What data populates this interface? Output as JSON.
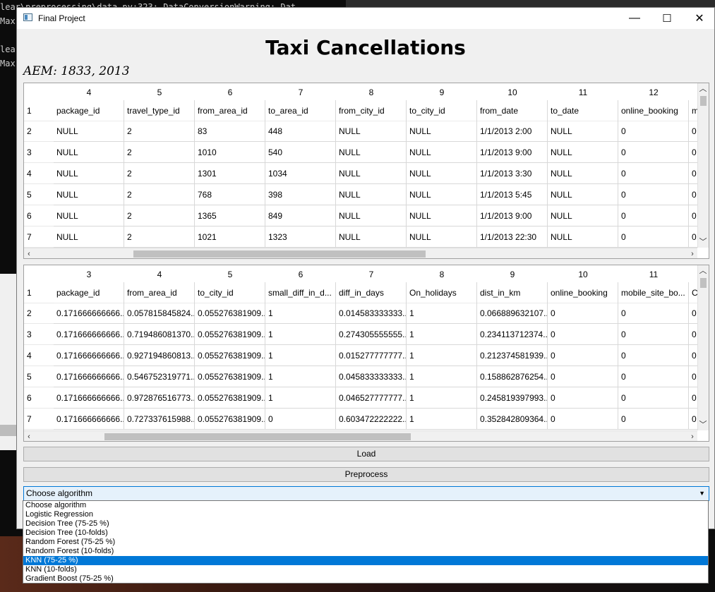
{
  "console": {
    "lines": [
      "lear\\preprocessing\\data.py:323: DataConversionWarning: Dat",
      "Max",
      "",
      "lear",
      "Max"
    ]
  },
  "window": {
    "title": "Final Project",
    "controls": {
      "minimize": "—",
      "maximize": "☐",
      "close": "✕"
    }
  },
  "heading": "Taxi Cancellations",
  "aem": "AEM: 1833, 2013",
  "table1": {
    "col_numbers": [
      "4",
      "5",
      "6",
      "7",
      "8",
      "9",
      "10",
      "11",
      "12"
    ],
    "rows": [
      {
        "num": "1",
        "cells": [
          "package_id",
          "travel_type_id",
          "from_area_id",
          "to_area_id",
          "from_city_id",
          "to_city_id",
          "from_date",
          "to_date",
          "online_booking",
          "m"
        ]
      },
      {
        "num": "2",
        "cells": [
          "NULL",
          "2",
          "83",
          "448",
          "NULL",
          "NULL",
          "1/1/2013 2:00",
          "NULL",
          "0",
          "0"
        ]
      },
      {
        "num": "3",
        "cells": [
          "NULL",
          "2",
          "1010",
          "540",
          "NULL",
          "NULL",
          "1/1/2013 9:00",
          "NULL",
          "0",
          "0"
        ]
      },
      {
        "num": "4",
        "cells": [
          "NULL",
          "2",
          "1301",
          "1034",
          "NULL",
          "NULL",
          "1/1/2013 3:30",
          "NULL",
          "0",
          "0"
        ]
      },
      {
        "num": "5",
        "cells": [
          "NULL",
          "2",
          "768",
          "398",
          "NULL",
          "NULL",
          "1/1/2013 5:45",
          "NULL",
          "0",
          "0"
        ]
      },
      {
        "num": "6",
        "cells": [
          "NULL",
          "2",
          "1365",
          "849",
          "NULL",
          "NULL",
          "1/1/2013 9:00",
          "NULL",
          "0",
          "0"
        ]
      },
      {
        "num": "7",
        "cells": [
          "NULL",
          "2",
          "1021",
          "1323",
          "NULL",
          "NULL",
          "1/1/2013 22:30",
          "NULL",
          "0",
          "0"
        ]
      }
    ]
  },
  "table2": {
    "col_numbers": [
      "3",
      "4",
      "5",
      "6",
      "7",
      "8",
      "9",
      "10",
      "11"
    ],
    "rows": [
      {
        "num": "1",
        "cells": [
          "package_id",
          "from_area_id",
          "to_city_id",
          "small_diff_in_d...",
          "diff_in_days",
          "On_holidays",
          "dist_in_km",
          "online_booking",
          "mobile_site_bo...",
          "C"
        ]
      },
      {
        "num": "2",
        "cells": [
          "0.171666666666...",
          "0.057815845824...",
          "0.055276381909...",
          "1",
          "0.014583333333...",
          "1",
          "0.066889632107...",
          "0",
          "0",
          "0"
        ]
      },
      {
        "num": "3",
        "cells": [
          "0.171666666666...",
          "0.719486081370...",
          "0.055276381909...",
          "1",
          "0.274305555555...",
          "1",
          "0.234113712374...",
          "0",
          "0",
          "0"
        ]
      },
      {
        "num": "4",
        "cells": [
          "0.171666666666...",
          "0.927194860813...",
          "0.055276381909...",
          "1",
          "0.015277777777...",
          "1",
          "0.212374581939...",
          "0",
          "0",
          "0"
        ]
      },
      {
        "num": "5",
        "cells": [
          "0.171666666666...",
          "0.546752319771...",
          "0.055276381909...",
          "1",
          "0.045833333333...",
          "1",
          "0.158862876254...",
          "0",
          "0",
          "0"
        ]
      },
      {
        "num": "6",
        "cells": [
          "0.171666666666...",
          "0.972876516773...",
          "0.055276381909...",
          "1",
          "0.046527777777...",
          "1",
          "0.245819397993...",
          "0",
          "0",
          "0"
        ]
      },
      {
        "num": "7",
        "cells": [
          "0.171666666666...",
          "0.727337615988...",
          "0.055276381909...",
          "0",
          "0.603472222222...",
          "1",
          "0.352842809364...",
          "0",
          "0",
          "0"
        ]
      }
    ]
  },
  "buttons": {
    "load": "Load",
    "preprocess": "Preprocess"
  },
  "algorithm": {
    "selected": "Choose algorithm",
    "options": [
      "Choose algorithm",
      "Logistic Regression",
      "Decision Tree (75-25 %)",
      "Decision Tree (10-folds)",
      "Random Forest (75-25 %)",
      "Random Forest (10-folds)",
      "KNN (75-25 %)",
      "KNN (10-folds)",
      "Gradient Boost (75-25 %)"
    ],
    "highlighted_index": 6
  }
}
